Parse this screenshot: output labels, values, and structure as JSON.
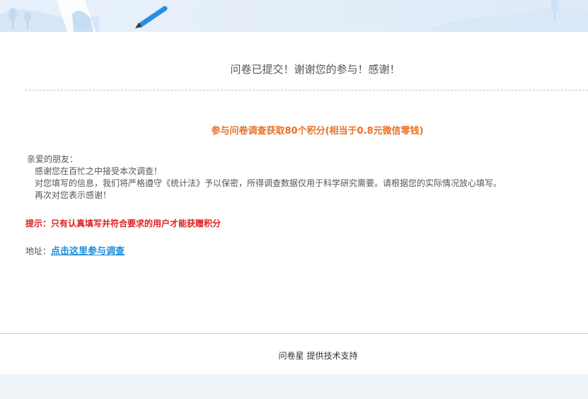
{
  "header": {
    "banner_icon": "pen-icon"
  },
  "main": {
    "title": "问卷已提交！谢谢您的参与！感谢！",
    "reward": "参与问卷调查获取80个积分(相当于0.8元微信零钱)",
    "letter": {
      "greeting": "亲爱的朋友：",
      "line1": "感谢您在百忙之中接受本次调查！",
      "line2": "对您填写的信息，我们将严格遵守《统计法》予以保密，所得调查数据仅用于科学研究需要。请根据您的实际情况放心填写。",
      "line3": "再次对您表示感谢！"
    },
    "tip": "提示：只有认真填写并符合要求的用户才能获赠积分",
    "address_label": "地址：",
    "address_link": "点击这里参与调查"
  },
  "footer": {
    "brand": "问卷星",
    "support": "提供技术支持"
  },
  "colors": {
    "reward": "#ec7024",
    "tip": "#e02020",
    "link": "#1a8ed8",
    "pen": "#2a8ee0"
  }
}
